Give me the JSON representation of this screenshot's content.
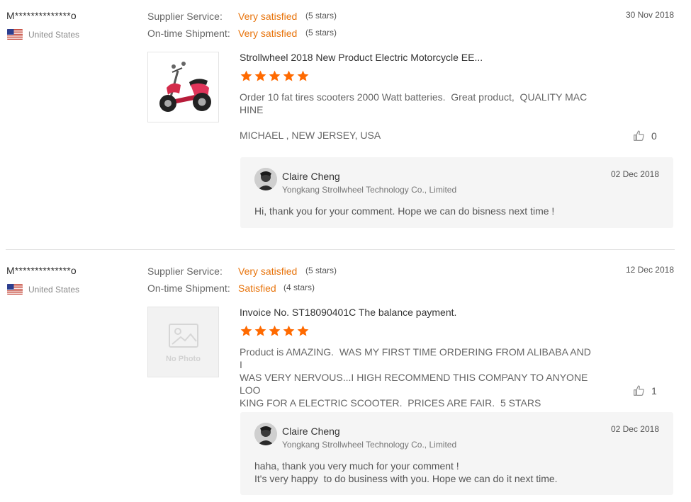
{
  "reviews": [
    {
      "buyer": "M**************o",
      "country": "United States",
      "date": "30 Nov 2018",
      "supplier_service": {
        "label": "Supplier Service:",
        "value": "Very satisfied",
        "stars": "(5 stars)"
      },
      "on_time_shipment": {
        "label": "On-time Shipment:",
        "value": "Very satisfied",
        "stars": "(5 stars)"
      },
      "product_title": "Strollwheel 2018 New Product Electric Motorcycle EE...",
      "product_image": "electric-scooter-photo",
      "rating": 5,
      "comment": "Order 10 fat tires scooters 2000 Watt batteries.  Great product,  QUALITY MAC\nHINE",
      "signature": "MICHAEL , NEW JERSEY, USA",
      "likes": "0",
      "reply": {
        "name": "Claire Cheng",
        "company": "Yongkang Strollwheel Technology Co., Limited",
        "date": "02 Dec 2018",
        "text": "Hi, thank you for your comment. Hope we can do bisness next time !"
      }
    },
    {
      "buyer": "M**************o",
      "country": "United States",
      "date": "12 Dec 2018",
      "supplier_service": {
        "label": "Supplier Service:",
        "value": "Very satisfied",
        "stars": "(5 stars)"
      },
      "on_time_shipment": {
        "label": "On-time Shipment:",
        "value": "Satisfied",
        "stars": "(4 stars)"
      },
      "product_title": "Invoice No. ST18090401C The balance payment.",
      "product_image": "No Photo",
      "rating": 5,
      "comment": "Product is AMAZING.  WAS MY FIRST TIME ORDERING FROM ALIBABA AND I\nWAS VERY NERVOUS...I HIGH RECOMMEND THIS COMPANY TO ANYONE LOO\nKING FOR A ELECTRIC SCOOTER.  PRICES ARE FAIR.  5 STARS",
      "likes": "1",
      "reply": {
        "name": "Claire Cheng",
        "company": "Yongkang Strollwheel Technology Co., Limited",
        "date": "02 Dec 2018",
        "text": "haha, thank you very much for your comment !\nIt's very happy  to do business with you. Hope we can do it next time."
      }
    }
  ],
  "colors": {
    "accent": "#e8740c",
    "reply_bg": "#f5f5f5",
    "star": "#ff6a00"
  }
}
